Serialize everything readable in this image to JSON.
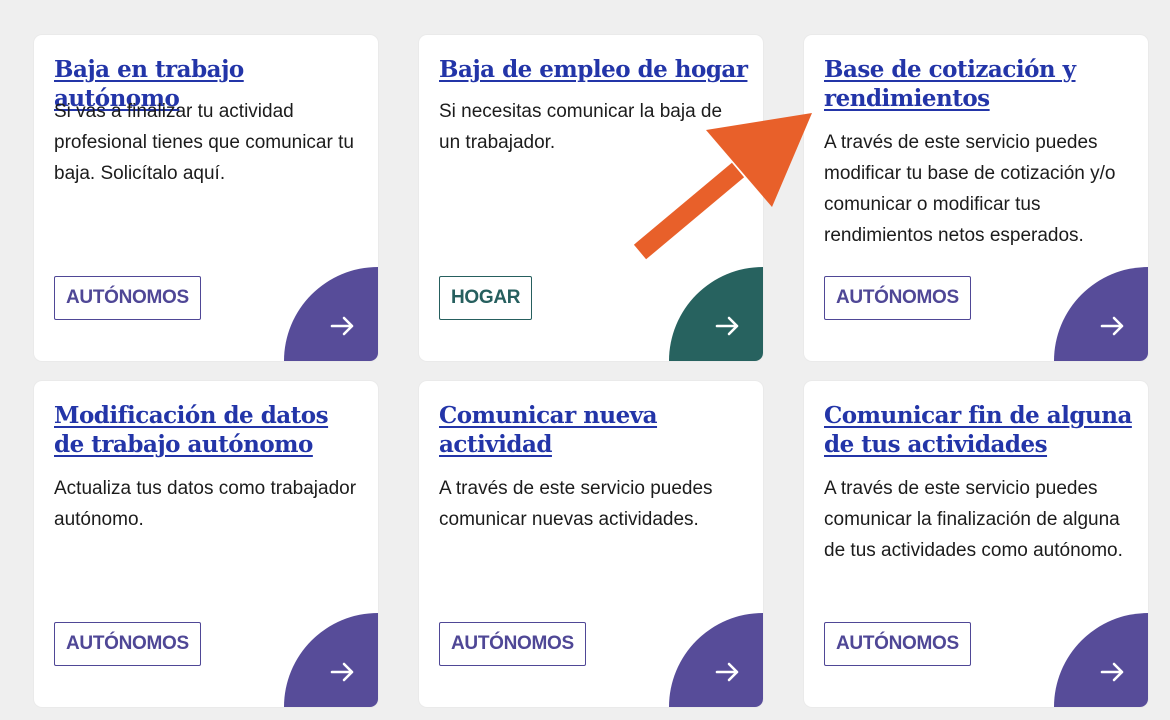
{
  "colors": {
    "background": "#efefef",
    "card": "#ffffff",
    "title_link": "#2335a8",
    "purple": "#574c99",
    "teal": "#27625f",
    "annotation_orange": "#e8602a"
  },
  "cards": [
    {
      "title": "Baja en trabajo autónomo",
      "description": "Si vas a finalizar tu actividad profesional tienes que comunicar tu baja. Solicítalo aquí.",
      "tag": "AUTÓNOMOS",
      "theme": "purple",
      "arrow_icon": "arrow-right-icon"
    },
    {
      "title": "Baja de empleo de hogar",
      "description": "Si necesitas comunicar la baja de un trabajador.",
      "tag": "HOGAR",
      "theme": "teal",
      "arrow_icon": "arrow-right-icon"
    },
    {
      "title": "Base de cotización y rendimientos",
      "description": "A través de este servicio puedes modificar tu base de cotización y/o comunicar o modificar tus rendimientos netos esperados.",
      "tag": "AUTÓNOMOS",
      "theme": "purple",
      "arrow_icon": "arrow-right-icon"
    },
    {
      "title": "Modificación de datos de trabajo autónomo",
      "description": "Actualiza tus datos como trabajador autónomo.",
      "tag": "AUTÓNOMOS",
      "theme": "purple",
      "arrow_icon": "arrow-right-icon"
    },
    {
      "title": "Comunicar nueva actividad",
      "description": "A través de este servicio puedes comunicar nuevas actividades.",
      "tag": "AUTÓNOMOS",
      "theme": "purple",
      "arrow_icon": "arrow-right-icon"
    },
    {
      "title": "Comunicar fin de alguna de tus actividades",
      "description": "A través de este servicio puedes comunicar la finalización de alguna de tus actividades como autónomo.",
      "tag": "AUTÓNOMOS",
      "theme": "purple",
      "arrow_icon": "arrow-right-icon"
    }
  ],
  "annotation": {
    "icon": "pointer-arrow-icon",
    "color": "#e8602a"
  }
}
